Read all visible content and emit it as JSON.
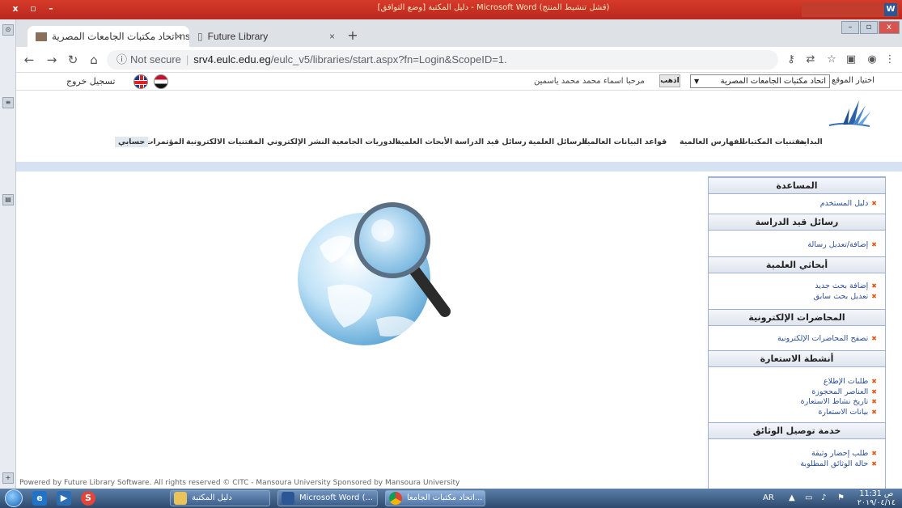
{
  "word_window": {
    "title": "دليل المكتبة [وضع التوافق] - Microsoft Word (فشل تنشيط المنتج)"
  },
  "browser": {
    "tabs": [
      {
        "label": "اتحاد مكتبات الجامعات المصرية nsortium",
        "close": "×"
      },
      {
        "label": "Future Library",
        "close": "×"
      }
    ],
    "new_tab": "+",
    "address": {
      "security": "Not secure",
      "host": "srv4.eulc.edu.eg",
      "path": "/eulc_v5/libraries/start.aspx?fn=Login&ScopeID=1."
    }
  },
  "header": {
    "logout": "تسجيل خروج",
    "welcome": "مرحبا  اسماء محمد محمد ياسمين",
    "go_button": "اذهب",
    "site_selected": "اتحاد مكتبات الجامعات المصرية",
    "site_label": "اختيار الموقع"
  },
  "nav": [
    "البداية",
    "مقتنيات المكتبات",
    "الفهارس العالمية",
    "قواعد البيانات العالمية",
    "الرسائل العلمية",
    "رسائل قيد الدراسة",
    "الأبحاث العلمية",
    "الدوريات الجامعية",
    "النشر الإلكتروني",
    "المقتنيات الالكترونية",
    "المؤتمرات",
    "حسابي"
  ],
  "sidebar": [
    {
      "title": "المساعدة",
      "links": [
        "دليل المستخدم"
      ]
    },
    {
      "title": "رسائل قيد الدراسة",
      "links": [
        "إضافة/تعديل رسالة"
      ]
    },
    {
      "title": "أبحاثي العلمية",
      "links": [
        "إضافة بحث جديد",
        "تعديل بحث سابق"
      ]
    },
    {
      "title": "المحاضرات الإلكترونية",
      "links": [
        "تصفح المحاضرات الإلكترونية"
      ]
    },
    {
      "title": "أنشطة الاستعارة",
      "links": [
        "طلبات الإطلاع",
        "العناصر المحجوزة",
        "تاريخ نشاط الاستعارة",
        "بيانات الاستعارة"
      ]
    },
    {
      "title": "خدمة توصيل الوثائق",
      "links": [
        "طلب إحضار وثيقة",
        "حالة الوثائق المطلوبة"
      ]
    }
  ],
  "footer": {
    "text": "Powered by Future Library Software. All rights reserved © CITC - Mansoura University        Sponsored by Mansoura University"
  },
  "taskbar": {
    "tasks": [
      "دليل المكتبة",
      "Microsoft Word (...",
      "اتحاد مكتبات الجامعا..."
    ],
    "lang": "AR",
    "time": "11:31 ص",
    "date": "٢٠١٩/٠٤/١٤"
  }
}
